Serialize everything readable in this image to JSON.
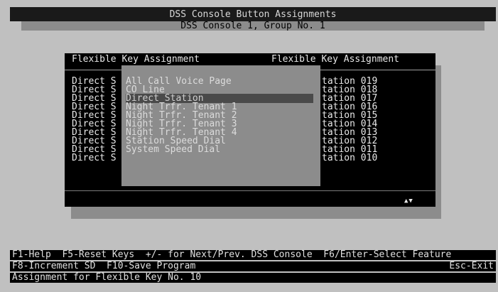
{
  "header": {
    "title": "DSS Console Button Assignments",
    "subtitle": "DSS Console 1, Group No. 1"
  },
  "grid": {
    "col_header_left": "Flexible Key Assignment",
    "col_header_right": "Flexible Key Assignment",
    "left_rows": [
      "Direct S",
      "Direct S",
      "Direct S",
      "Direct S",
      "Direct S",
      "Direct S",
      "Direct S",
      "Direct S",
      "Direct S",
      "Direct S"
    ],
    "right_rows": [
      "tation 019",
      "tation 018",
      "tation 017",
      "tation 016",
      "tation 015",
      "tation 014",
      "tation 013",
      "tation 012",
      "tation 011",
      "tation 010"
    ],
    "scroll_indicator": "▲▼"
  },
  "popup": {
    "items": [
      "All Call Voice Page",
      "CO Line",
      "Direct Station",
      "Night Trfr. Tenant 1",
      "Night Trfr. Tenant 2",
      "Night Trfr. Tenant 3",
      "Night Trfr. Tenant 4",
      "Station Speed Dial",
      "System Speed Dial"
    ],
    "selected_index": 2
  },
  "status": {
    "line1": "F1-Help  F5-Reset Keys  +/- for Next/Prev. DSS Console  F6/Enter-Select Feature",
    "line2_left": "F8-Increment SD  F10-Save Program",
    "line2_right": "Esc-Exit",
    "line3": "Assignment for Flexible Key No. 10"
  },
  "colors": {
    "background": "#c0c0c0",
    "panel": "#000000",
    "popup": "#8c8c8c",
    "selected": "#4a4a4a"
  }
}
